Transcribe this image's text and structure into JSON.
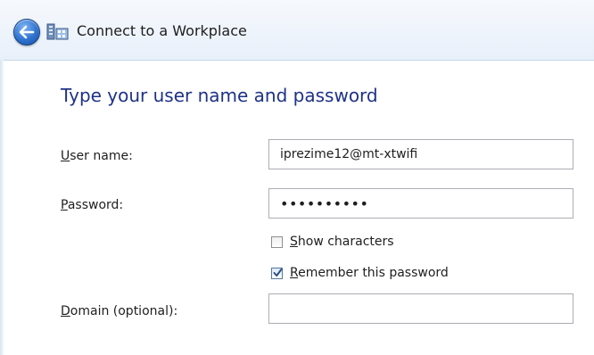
{
  "window": {
    "title": "Connect to a Workplace",
    "back_icon": "back-arrow-icon",
    "app_icon": "network-workplace-icon"
  },
  "form": {
    "heading": "Type your user name and password",
    "username": {
      "label_accel": "U",
      "label_rest": "ser name:",
      "value": "iprezime12@mt-xtwifi"
    },
    "password": {
      "label_accel": "P",
      "label_rest": "assword:",
      "value": "••••••••••"
    },
    "show_characters": {
      "label_accel": "S",
      "label_rest": "how characters",
      "checked": false
    },
    "remember_password": {
      "label_accel": "R",
      "label_rest": "emember this password",
      "checked": true
    },
    "domain": {
      "label_accel": "D",
      "label_rest": "omain (optional):",
      "value": ""
    }
  },
  "colors": {
    "heading": "#1e3287",
    "header_bg": "#eef4fb",
    "back_button": "#2f73d0"
  }
}
